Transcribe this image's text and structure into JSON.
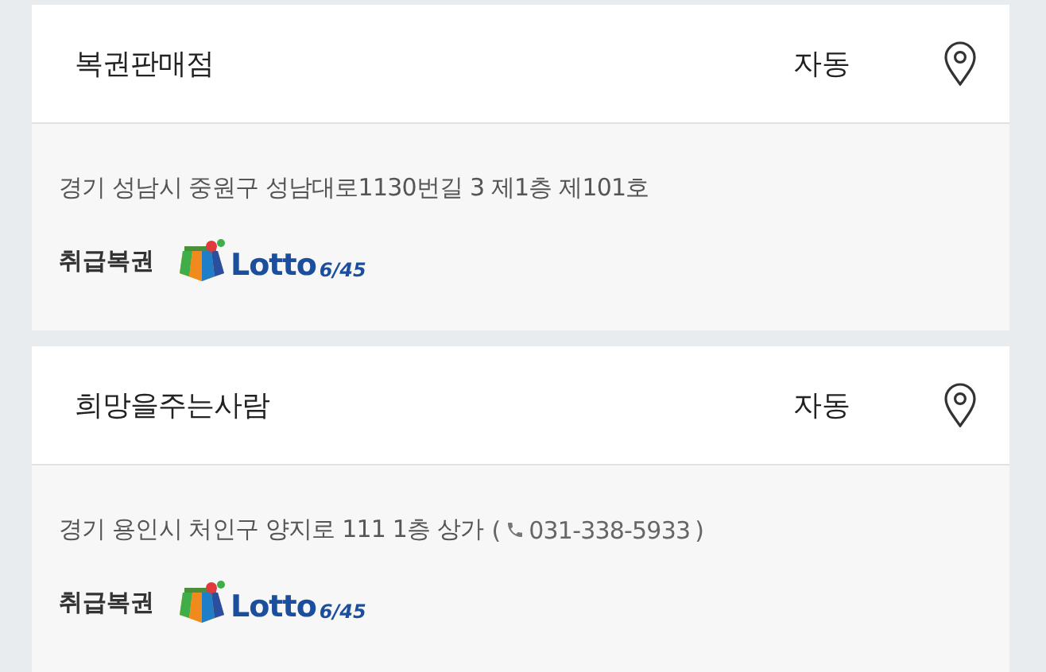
{
  "stores": [
    {
      "name": "복권판매점",
      "method": "자동",
      "address": "경기 성남시 중원구 성남대로1130번길 3 제1층 제101호",
      "games_label": "취급복권",
      "games": [
        {
          "name": "Lotto",
          "suffix": "6/45"
        }
      ]
    },
    {
      "name": "희망을주는사람",
      "method": "자동",
      "address": "경기 용인시 처인구 양지로 111 1층 상가",
      "phone_open": "(",
      "phone": "031-338-5933",
      "phone_close": ")",
      "games_label": "취급복권",
      "games": [
        {
          "name": "Lotto",
          "suffix": "6/45"
        }
      ]
    }
  ]
}
